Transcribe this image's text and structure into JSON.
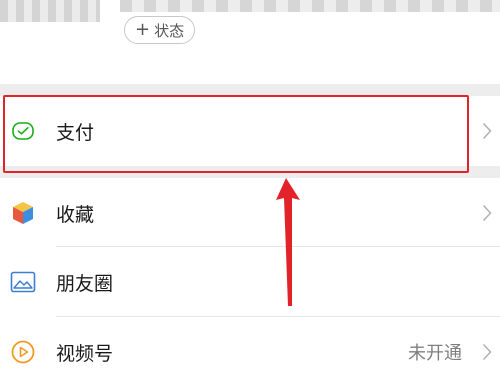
{
  "profile": {
    "status_label": "状态",
    "status_plus": "+"
  },
  "menu": {
    "items": [
      {
        "label": "支付",
        "icon": "wechat-pay-icon",
        "value": ""
      },
      {
        "label": "收藏",
        "icon": "favorites-cube-icon",
        "value": ""
      },
      {
        "label": "朋友圈",
        "icon": "moments-photo-icon",
        "value": ""
      },
      {
        "label": "视频号",
        "icon": "channels-play-icon",
        "value": "未开通"
      }
    ]
  },
  "colors": {
    "highlight": "#e2232a",
    "pay_green": "#1aad19",
    "chevron": "#b2b2b2",
    "gap": "#ededed"
  }
}
